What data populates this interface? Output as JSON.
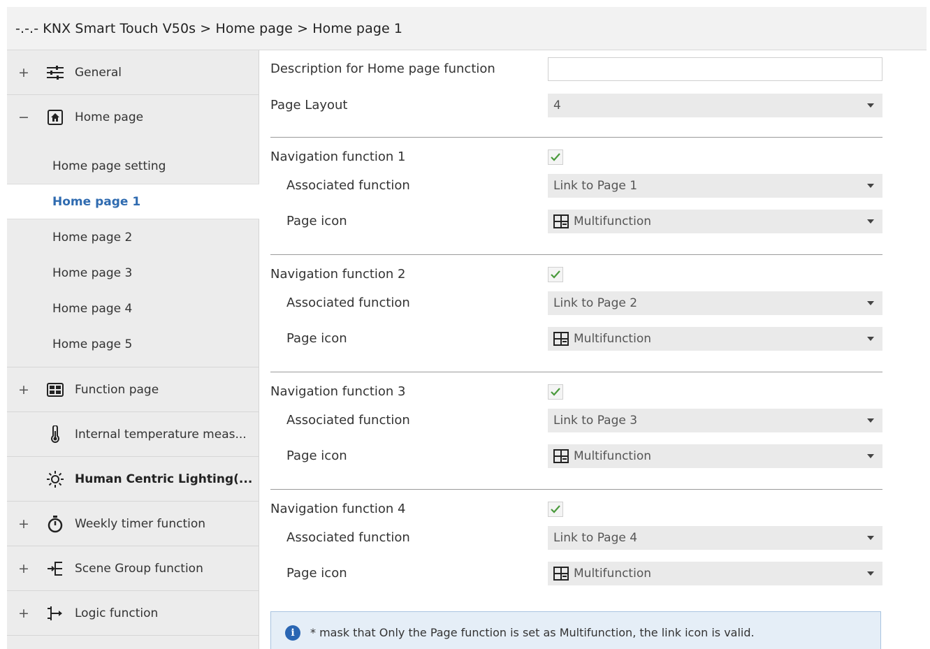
{
  "window": {
    "title": "-.-.- KNX Smart Touch V50s > Home page > Home page 1"
  },
  "sidebar": {
    "general": {
      "expander": "+",
      "label": "General",
      "icon": "sliders-icon"
    },
    "home_page": {
      "expander": "−",
      "label": "Home page",
      "icon": "home-icon",
      "children": [
        "Home page setting",
        "Home page 1",
        "Home page 2",
        "Home page 3",
        "Home page 4",
        "Home page 5"
      ],
      "active_child": "Home page 1"
    },
    "function_page": {
      "expander": "+",
      "label": "Function page",
      "icon": "grid-icon"
    },
    "internal_temp": {
      "label": "Internal temperature meas...",
      "icon": "thermometer-icon"
    },
    "hcl": {
      "label": "Human Centric Lighting(...",
      "icon": "sun-icon"
    },
    "weekly_timer": {
      "expander": "+",
      "label": "Weekly timer function",
      "icon": "timer-icon"
    },
    "scene_group": {
      "expander": "+",
      "label": "Scene Group function",
      "icon": "scene-tree-icon"
    },
    "logic": {
      "expander": "+",
      "label": "Logic function",
      "icon": "logic-icon"
    }
  },
  "main": {
    "description": {
      "label": "Description for Home page function",
      "value": ""
    },
    "page_layout": {
      "label": "Page Layout",
      "value": "4"
    },
    "navigation": [
      {
        "label": "Navigation function 1",
        "checked": true,
        "assoc_label": "Associated function",
        "assoc_value": "Link to Page 1",
        "icon_label": "Page icon",
        "icon_value": "Multifunction"
      },
      {
        "label": "Navigation function 2",
        "checked": true,
        "assoc_label": "Associated function",
        "assoc_value": "Link to Page 2",
        "icon_label": "Page icon",
        "icon_value": "Multifunction"
      },
      {
        "label": "Navigation function 3",
        "checked": true,
        "assoc_label": "Associated function",
        "assoc_value": "Link to Page 3",
        "icon_label": "Page icon",
        "icon_value": "Multifunction"
      },
      {
        "label": "Navigation function 4",
        "checked": true,
        "assoc_label": "Associated function",
        "assoc_value": "Link to Page 4",
        "icon_label": "Page icon",
        "icon_value": "Multifunction"
      }
    ],
    "info": {
      "icon": "info-icon",
      "text": "* mask that Only the Page function is set as Multifunction, the link icon is valid."
    }
  },
  "colors": {
    "accent": "#2f6bb0",
    "check": "#4a9a3c",
    "info_bg": "#e5eef7",
    "sidebar_bg": "#ececec"
  }
}
